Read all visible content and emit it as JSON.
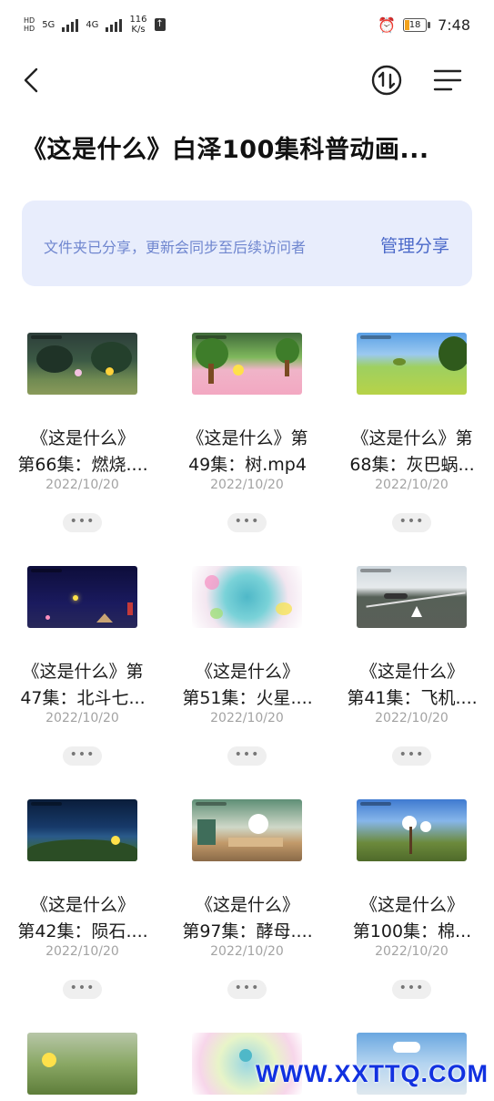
{
  "status_bar": {
    "network_left": "5G",
    "network_right": "4G",
    "speed_value": "116",
    "speed_unit": "K/s",
    "battery": "18",
    "time": "7:48"
  },
  "toolbar": {
    "back_icon": "chevron-left-icon",
    "sort_icon": "sort-icon",
    "menu_icon": "menu-icon"
  },
  "page_title": "《这是什么》白泽100集科普动画...",
  "share_banner": {
    "text": "文件夹已分享，更新会同步至后续访问者",
    "button": "管理分享"
  },
  "files": [
    {
      "line1": "《这是什么》",
      "line2": "第66集：燃烧....",
      "date": "2022/10/20",
      "more": "•••",
      "thumb": "forest-scene"
    },
    {
      "line1": "《这是什么》第",
      "line2": "49集：树.mp4",
      "date": "2022/10/20",
      "more": "•••",
      "thumb": "tree-cartoon"
    },
    {
      "line1": "《这是什么》第",
      "line2": "68集：灰巴蜗...",
      "date": "2022/10/20",
      "more": "•••",
      "thumb": "grass-field"
    },
    {
      "line1": "《这是什么》第",
      "line2": "47集：北斗七...",
      "date": "2022/10/20",
      "more": "•••",
      "thumb": "night-sky"
    },
    {
      "line1": "《这是什么》",
      "line2": "第51集：火星....",
      "date": "2022/10/20",
      "more": "•••",
      "thumb": "mars-blur"
    },
    {
      "line1": "《这是什么》",
      "line2": "第41集：飞机....",
      "date": "2022/10/20",
      "more": "•••",
      "thumb": "runway"
    },
    {
      "line1": "《这是什么》",
      "line2": "第42集：陨石....",
      "date": "2022/10/20",
      "more": "•••",
      "thumb": "lake-night"
    },
    {
      "line1": "《这是什么》",
      "line2": "第97集：酵母....",
      "date": "2022/10/20",
      "more": "•••",
      "thumb": "kitchen"
    },
    {
      "line1": "《这是什么》",
      "line2": "第100集：棉...",
      "date": "2022/10/20",
      "more": "•••",
      "thumb": "cotton"
    }
  ],
  "watermark": "WWW.XXTTQ.COM"
}
